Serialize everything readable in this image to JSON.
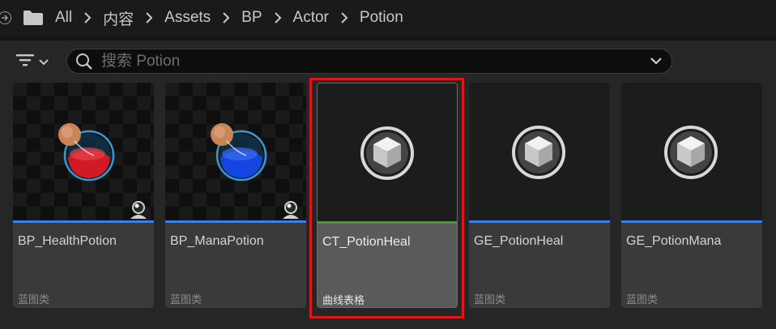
{
  "breadcrumb": {
    "items": [
      "All",
      "内容",
      "Assets",
      "BP",
      "Actor",
      "Potion"
    ]
  },
  "search": {
    "placeholder": "搜索 Potion",
    "value": ""
  },
  "colors": {
    "blueprint_stripe": "#3d7ee6",
    "curvetable_stripe": "#4a9a2a",
    "selection_highlight": "#e0141b"
  },
  "assets": [
    {
      "name": "BP_HealthPotion",
      "type": "蓝图类",
      "icon": "red-potion-icon"
    },
    {
      "name": "BP_ManaPotion",
      "type": "蓝图类",
      "icon": "blue-potion-icon"
    },
    {
      "name": "CT_PotionHeal",
      "type": "曲线表格",
      "icon": "cube-icon",
      "selected": true
    },
    {
      "name": "GE_PotionHeal",
      "type": "蓝图类",
      "icon": "cube-icon"
    },
    {
      "name": "GE_PotionMana",
      "type": "蓝图类",
      "icon": "cube-icon"
    }
  ]
}
